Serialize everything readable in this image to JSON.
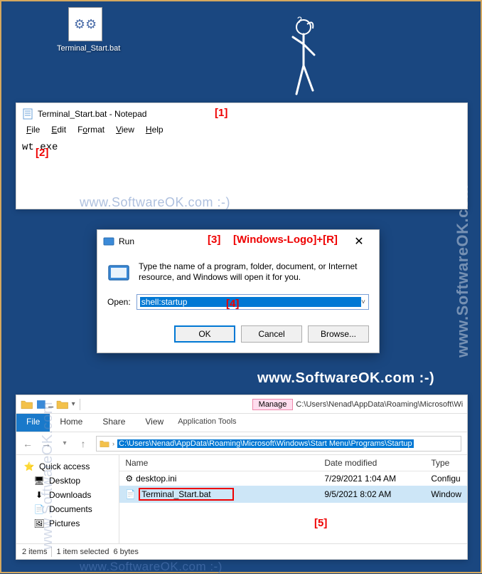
{
  "desktop_icon": {
    "label": "Terminal_Start.bat",
    "glyph": "⚙"
  },
  "notepad": {
    "title": "Terminal_Start.bat - Notepad",
    "menu": {
      "file": "File",
      "edit": "Edit",
      "format": "Format",
      "view": "View",
      "help": "Help"
    },
    "content": "wt.exe"
  },
  "run": {
    "title": "Run",
    "desc": "Type the name of a program, folder, document, or Internet resource, and Windows will open it for you.",
    "open_label": "Open:",
    "value": "shell:startup",
    "ok": "OK",
    "cancel": "Cancel",
    "browse": "Browse..."
  },
  "explorer": {
    "qat_title": "",
    "win_title_path": "C:\\Users\\Nenad\\AppData\\Roaming\\Microsoft\\Win",
    "tabs": {
      "file": "File",
      "home": "Home",
      "share": "Share",
      "view": "View",
      "manage": "Manage",
      "app_tools": "Application Tools"
    },
    "address": "C:\\Users\\Nenad\\AppData\\Roaming\\Microsoft\\Windows\\Start Menu\\Programs\\Startup",
    "sidebar": {
      "quick": "Quick access",
      "items": [
        "Desktop",
        "Downloads",
        "Documents",
        "Pictures"
      ]
    },
    "columns": {
      "name": "Name",
      "date": "Date modified",
      "type": "Type"
    },
    "rows": [
      {
        "name": "desktop.ini",
        "date": "7/29/2021 1:04 AM",
        "type": "Configu"
      },
      {
        "name": "Terminal_Start.bat",
        "date": "9/5/2021 8:02 AM",
        "type": "Window"
      }
    ],
    "status": {
      "count": "2 items",
      "selected": "1 item selected",
      "size": "6 bytes"
    }
  },
  "annotations": {
    "a1": "[1]",
    "a2": "[2]",
    "a3": "[3]",
    "a3b": "[Windows-Logo]+[R]",
    "a4": "[4]",
    "a5": "[5]"
  },
  "watermarks": {
    "w1": "www.SoftwareOK.com :-)",
    "w2": "www.SoftwareOK.com :-)",
    "w3": "www.SoftwareOK.com :-)",
    "w4": "www.SoftwareOK.com :-)",
    "w5": "www.SoftwareOK.com",
    "w6": "www.SoftwareOK.com"
  }
}
